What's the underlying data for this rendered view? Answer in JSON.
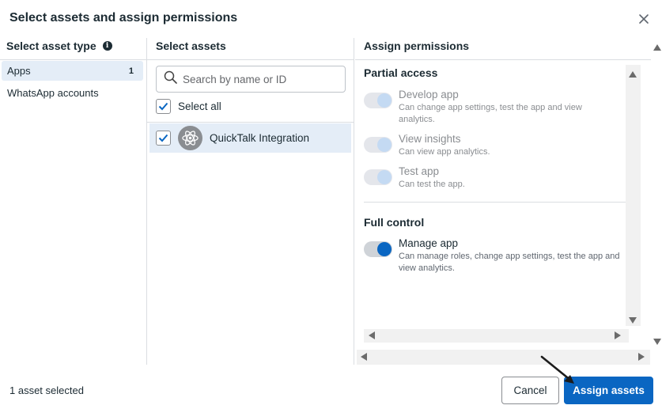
{
  "dialog": {
    "title": "Select assets and assign permissions"
  },
  "asset_types": {
    "header": "Select asset type",
    "items": [
      {
        "label": "Apps",
        "count": "1",
        "selected": true
      },
      {
        "label": "WhatsApp accounts",
        "count": "",
        "selected": false
      }
    ]
  },
  "assets": {
    "header": "Select assets",
    "search_placeholder": "Search by name or ID",
    "select_all_label": "Select all",
    "select_all_checked": true,
    "items": [
      {
        "name": "QuickTalk Integration",
        "checked": true,
        "icon": "atom-icon"
      }
    ]
  },
  "permissions": {
    "header": "Assign permissions",
    "sections": [
      {
        "title": "Partial access",
        "items": [
          {
            "name": "Develop app",
            "description": "Can change app settings, test the app and view analytics.",
            "enabled": false
          },
          {
            "name": "View insights",
            "description": "Can view app analytics.",
            "enabled": false
          },
          {
            "name": "Test app",
            "description": "Can test the app.",
            "enabled": false
          }
        ]
      },
      {
        "title": "Full control",
        "items": [
          {
            "name": "Manage app",
            "description": "Can manage roles, change app settings, test the app and view analytics.",
            "enabled": true
          }
        ]
      }
    ]
  },
  "footer": {
    "status": "1 asset selected",
    "cancel_label": "Cancel",
    "assign_label": "Assign assets"
  },
  "colors": {
    "accent": "#0a66c2",
    "selected_row": "#e4edf7",
    "text": "#1c2b33"
  }
}
